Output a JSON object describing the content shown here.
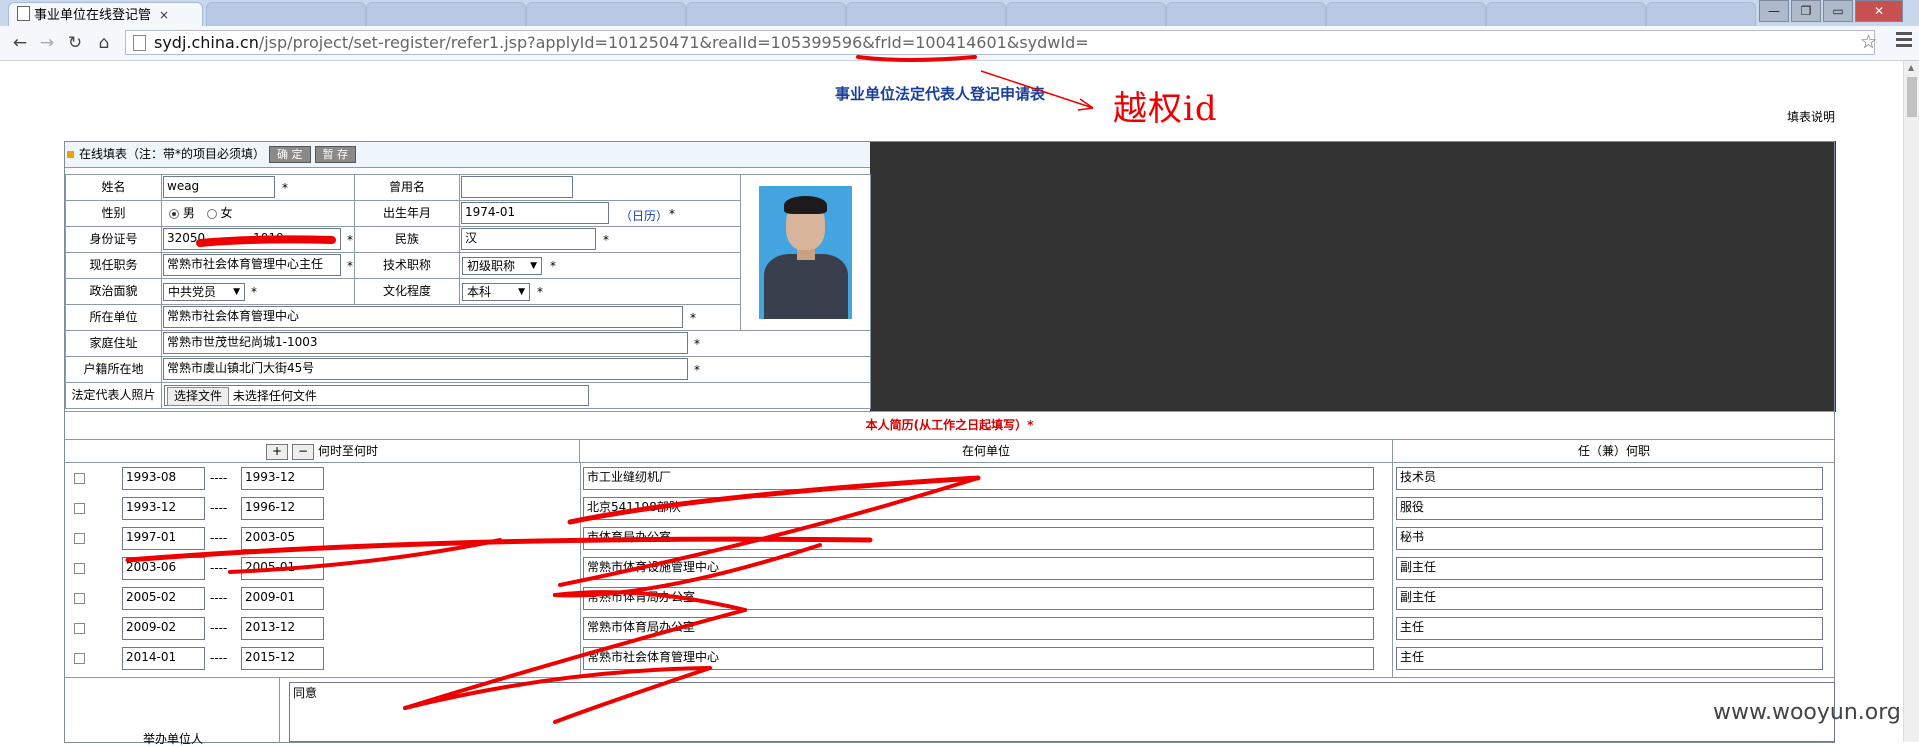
{
  "browser": {
    "active_tab": "事业单位在线登记管",
    "tab_close": "×",
    "url_host": "sydj.china.cn",
    "url_path": "/jsp/project/set-register/refer1.jsp?applyId=101250471&realId=105399596&frId=100414601&sydwId=",
    "win_min": "—",
    "win_max": "❐",
    "win_close": "✕"
  },
  "page": {
    "title": "事业单位法定代表人登记申请表",
    "annotation": "越权id",
    "help": "填表说明",
    "form_header": "在线填表（注：带*的项目必须填）",
    "btn_confirm": "确 定",
    "btn_save": "暂 存"
  },
  "form": {
    "name_label": "姓名",
    "name_value": "weag",
    "former_name_label": "曾用名",
    "former_name_value": "",
    "gender_label": "性别",
    "gender_male": "男",
    "gender_female": "女",
    "birth_label": "出生年月",
    "birth_value": "1974-01",
    "calendar": "（日历）",
    "id_label": "身份证号",
    "id_value": "32050　　　　1019",
    "ethnic_label": "民族",
    "ethnic_value": "汉",
    "position_label": "现任职务",
    "position_value": "常熟市社会体育管理中心主任",
    "tech_label": "技术职称",
    "tech_value": "初级职称",
    "political_label": "政治面貌",
    "political_value": "中共党员",
    "edu_label": "文化程度",
    "edu_value": "本科",
    "unit_label": "所在单位",
    "unit_value": "常熟市社会体育管理中心",
    "home_label": "家庭住址",
    "home_value": "常熟市世茂世纪尚城1-1003",
    "hukou_label": "户籍所在地",
    "hukou_value": "常熟市虞山镇北门大街45号",
    "photo_label": "法定代表人照片",
    "file_btn": "选择文件",
    "file_none": "未选择任何文件",
    "req": "*"
  },
  "resume": {
    "title": "本人简历(从工作之日起填写）*",
    "col_time": "何时至何时",
    "col_unit": "在何单位",
    "col_post": "任（兼）何职",
    "add": "+",
    "remove": "−",
    "sep": "----",
    "rows": [
      {
        "from": "1993-08",
        "to": "1993-12",
        "unit": "市工业缝纫机厂",
        "post": "技术员"
      },
      {
        "from": "1993-12",
        "to": "1996-12",
        "unit": "北京541198部队",
        "post": "服役"
      },
      {
        "from": "1997-01",
        "to": "2003-05",
        "unit": "市体育局办公室",
        "post": "秘书"
      },
      {
        "from": "2003-06",
        "to": "2005-01",
        "unit": "常熟市体育设施管理中心",
        "post": "副主任"
      },
      {
        "from": "2005-02",
        "to": "2009-01",
        "unit": "常熟市体育局办公室",
        "post": "副主任"
      },
      {
        "from": "2009-02",
        "to": "2013-12",
        "unit": "常熟市体育局办公室",
        "post": "主任"
      },
      {
        "from": "2014-01",
        "to": "2015-12",
        "unit": "常熟市社会体育管理中心",
        "post": "主任"
      }
    ]
  },
  "remark": {
    "label": "举办单位人",
    "value": "同意"
  },
  "watermark": "www.wooyun.org"
}
